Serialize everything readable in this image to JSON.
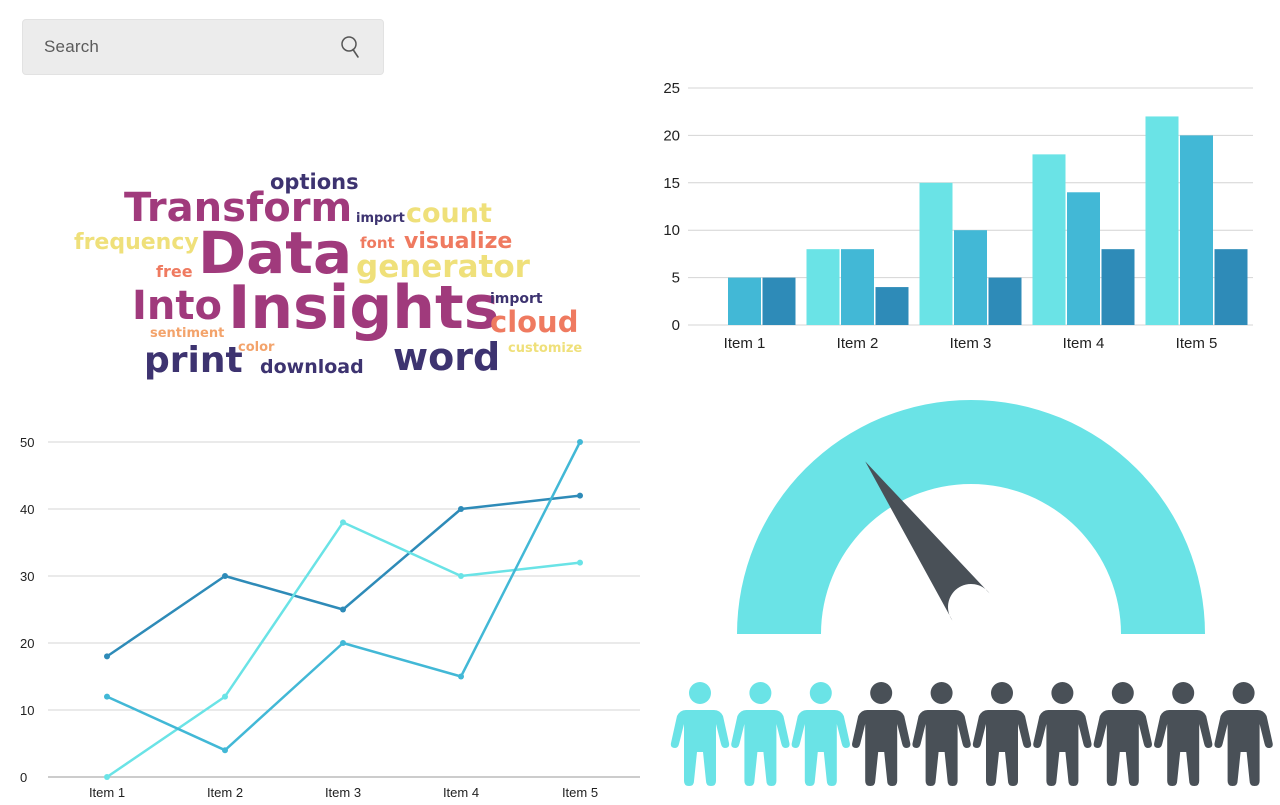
{
  "search": {
    "placeholder": "Search",
    "icon": "search-icon"
  },
  "wordcloud": {
    "words": [
      {
        "text": "options",
        "color": "#3d3370"
      },
      {
        "text": "Transform",
        "color": "#a03a7c"
      },
      {
        "text": "import",
        "color": "#3d3370"
      },
      {
        "text": "count",
        "color": "#efe07a"
      },
      {
        "text": "frequency",
        "color": "#efe07a"
      },
      {
        "text": "Data",
        "color": "#a03a7c"
      },
      {
        "text": "font",
        "color": "#ef7a60"
      },
      {
        "text": "visualize",
        "color": "#ef7a60"
      },
      {
        "text": "free",
        "color": "#ef7a60"
      },
      {
        "text": "generator",
        "color": "#efe07a"
      },
      {
        "text": "Into",
        "color": "#a03a7c"
      },
      {
        "text": "Insights",
        "color": "#a03a7c"
      },
      {
        "text": "import",
        "color": "#3d3370"
      },
      {
        "text": "cloud",
        "color": "#ef7a60"
      },
      {
        "text": "sentiment",
        "color": "#f3a36b"
      },
      {
        "text": "color",
        "color": "#f3a36b"
      },
      {
        "text": "customize",
        "color": "#efe07a"
      },
      {
        "text": "print",
        "color": "#3d3370"
      },
      {
        "text": "download",
        "color": "#3d3370"
      },
      {
        "text": "word",
        "color": "#3d3370"
      }
    ]
  },
  "chart_data": [
    {
      "type": "bar",
      "categories": [
        "Item 1",
        "Item 2",
        "Item 3",
        "Item 4",
        "Item 5"
      ],
      "series": [
        {
          "values": [
            0,
            8,
            15,
            18,
            22
          ],
          "color": "#6ae3e6"
        },
        {
          "values": [
            5,
            8,
            10,
            14,
            20
          ],
          "color": "#42b8d6"
        },
        {
          "values": [
            5,
            4,
            5,
            8,
            8
          ],
          "color": "#2e8bb8"
        }
      ],
      "ylim": [
        0,
        25
      ],
      "yticks": [
        "0",
        "5",
        "10",
        "15",
        "20",
        "25"
      ],
      "grid": true
    },
    {
      "type": "line",
      "categories": [
        "Item 1",
        "Item 2",
        "Item 3",
        "Item 4",
        "Item 5"
      ],
      "series": [
        {
          "values": [
            18,
            30,
            25,
            40,
            42
          ],
          "color": "#2e8bb8"
        },
        {
          "values": [
            0,
            12,
            38,
            30,
            32
          ],
          "color": "#6ae3e6"
        },
        {
          "values": [
            12,
            4,
            20,
            15,
            50
          ],
          "color": "#42b8d6"
        }
      ],
      "ylim": [
        0,
        50
      ],
      "yticks": [
        "0",
        "10",
        "20",
        "30",
        "40",
        "50"
      ],
      "grid": true
    }
  ],
  "gauge": {
    "value_fraction": 0.3,
    "arc_color": "#6ae3e6",
    "needle_color": "#495057"
  },
  "people": {
    "total": 10,
    "highlighted": 3,
    "highlight_color": "#6ae3e6",
    "base_color": "#495057",
    "icon": "person-icon"
  }
}
